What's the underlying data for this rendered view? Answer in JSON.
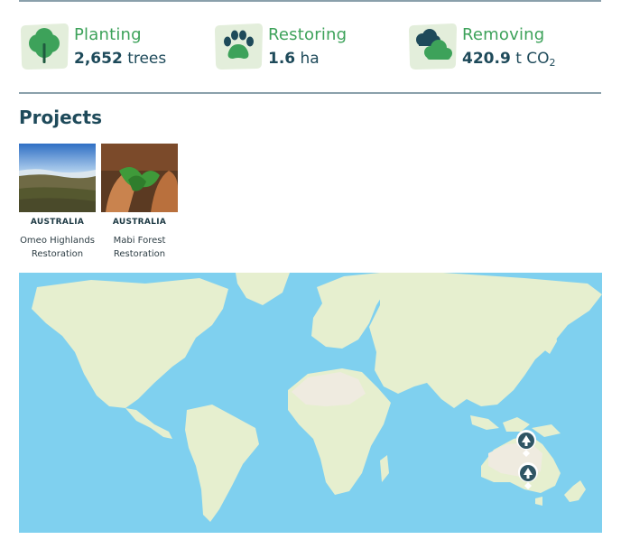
{
  "stats": [
    {
      "title": "Planting",
      "value": "2,652",
      "unit": "trees",
      "icon": "tree-icon"
    },
    {
      "title": "Restoring",
      "value": "1.6",
      "unit": "ha",
      "icon": "paw-icon"
    },
    {
      "title": "Removing",
      "value": "420.9",
      "unit": "t CO",
      "unit_sub": "2",
      "icon": "cloud-icon"
    }
  ],
  "projects": {
    "title": "Projects",
    "items": [
      {
        "country": "AUSTRALIA",
        "name_line1": "Omeo Highlands",
        "name_line2": "Restoration"
      },
      {
        "country": "AUSTRALIA",
        "name_line1": "Mabi Forest",
        "name_line2": "Restoration"
      }
    ]
  },
  "colors": {
    "accent_green": "#3da25a",
    "dark_teal": "#1e4a5a",
    "blob_green": "#e3eedb",
    "ocean": "#7fd0ef",
    "land": "#e6efcf"
  }
}
